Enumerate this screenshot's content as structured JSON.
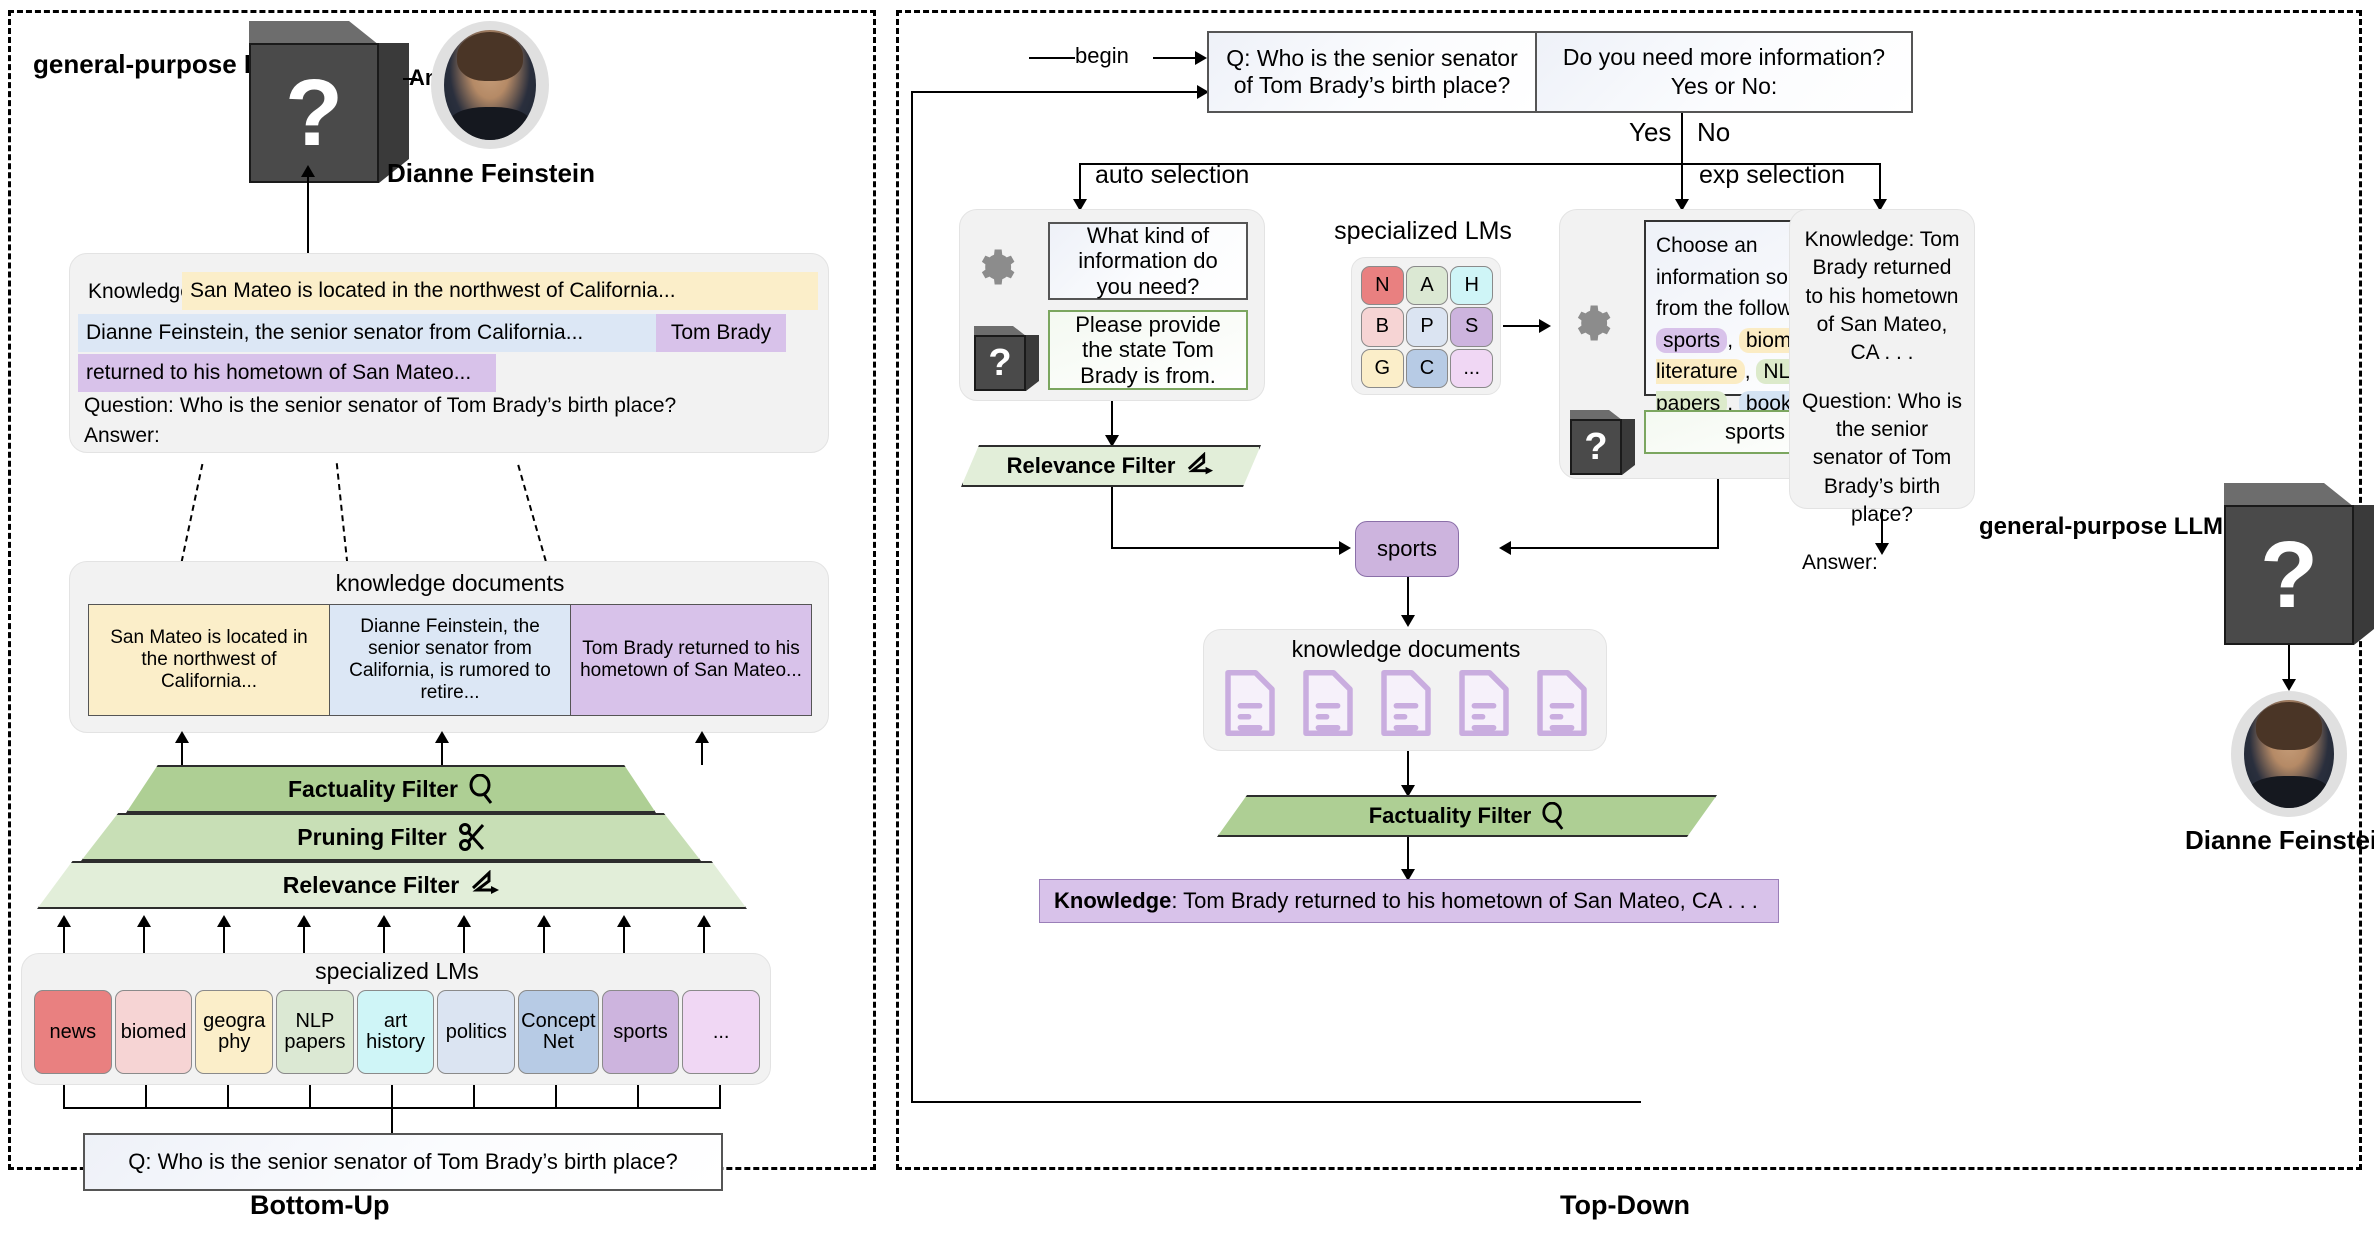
{
  "figure": {
    "caption_left": "Bottom-Up",
    "caption_right": "Top-Down"
  },
  "left": {
    "llm_label": "general-purpose LLM",
    "llm_glyph": "?",
    "answer_edge_label": "Answer:→",
    "person_name": "Dianne Feinstein",
    "prompt_box": {
      "knowledge_label": "Knowledge:",
      "knowledge_yellow": "San Mateo is located in the northwest of California...",
      "knowledge_blue": "Dianne Feinstein, the senior senator from California...",
      "tag_purple": "Tom Brady",
      "knowledge_purple": "returned to his hometown of San Mateo...",
      "question_line": "Question: Who is the senior senator of Tom Brady’s birth place?",
      "answer_line": "Answer:"
    },
    "knowledge_docs": {
      "title": "knowledge documents",
      "docs": [
        "San Mateo is located in the northwest of California...",
        "Dianne Feinstein, the senior senator from California, is rumored to retire...",
        "Tom Brady returned to his hometown of San Mateo..."
      ]
    },
    "filters": [
      {
        "label": "Factuality Filter",
        "icon": "magnifier-icon"
      },
      {
        "label": "Pruning Filter",
        "icon": "scissors-icon"
      },
      {
        "label": "Relevance Filter",
        "icon": "relevance-arrow-icon"
      }
    ],
    "specialized_lms": {
      "title": "specialized LMs",
      "items": [
        "news",
        "biomed",
        "geogra phy",
        "NLP papers",
        "art history",
        "politics",
        "Concept Net",
        "sports",
        "..."
      ],
      "colors": [
        "#e98080",
        "#f6d4d4",
        "#fbeec9",
        "#dbe8d3",
        "#cff5f7",
        "#dbe4f2",
        "#b7cbe5",
        "#cdb4de",
        "#f0d7f4"
      ]
    },
    "question": "Q: Who is the senior senator of Tom Brady’s birth place?"
  },
  "right": {
    "begin_label": "begin",
    "query_box": "Q: Who is the senior senator of Tom Brady’s birth place?",
    "need_info_box": "Do you need more information?\nYes or No:",
    "yes_label": "Yes",
    "no_label": "No",
    "auto_selection_label": "auto selection",
    "exp_selection_label": "exp selection",
    "auto_panel": {
      "gear_icon": "gear-icon",
      "llm_icon": "black-box-llm-icon",
      "prompt": "What kind of information do you need?",
      "response": "Please provide the state Tom Brady is from."
    },
    "specialized_lms": {
      "title": "specialized LMs",
      "grid": [
        "N",
        "A",
        "H",
        "B",
        "P",
        "S",
        "G",
        "C",
        "..."
      ],
      "colors": [
        "#e98080",
        "#dbe8d3",
        "#cff5f7",
        "#f6d4d4",
        "#dbe4f2",
        "#cdb4de",
        "#fbeec9",
        "#b7cbe5",
        "#f0d7f4"
      ]
    },
    "exp_panel": {
      "gear_icon": "gear-icon",
      "llm_icon": "black-box-llm-icon",
      "prompt_prefix": "Choose an information source from the following:",
      "options": [
        "sports",
        "biomedical literature",
        "NLP papers",
        "book corpus"
      ],
      "option_colors": [
        "#d8c2ea",
        "#fbecc4",
        "#dceacb",
        "#d4e3f3"
      ],
      "separators": [
        ",",
        ",",
        ",",
        "."
      ],
      "response": "sports"
    },
    "no_branch_box": {
      "knowledge": "Knowledge: Tom Brady returned to his hometown of San Mateo, CA . . .",
      "question": "Question: Who is the senior senator of Tom Brady’s birth place?",
      "answer": "Answer:"
    },
    "relevance_filter": {
      "label": "Relevance Filter",
      "icon": "relevance-arrow-icon"
    },
    "factuality_filter": {
      "label": "Factuality Filter",
      "icon": "magnifier-icon"
    },
    "selected_source": "sports",
    "knowledge_docs_title": "knowledge documents",
    "knowledge_docs_count": 5,
    "knowledge_bar": {
      "label": "Knowledge",
      "text": ": Tom Brady returned to his hometown of San Mateo, CA . . ."
    },
    "llm_label": "general-purpose LLM",
    "llm_glyph": "?",
    "person_name": "Dianne Feinstein"
  },
  "colors": {
    "yellow": "#fbeec9",
    "blue": "#dce7f5",
    "purple": "#d8c2ea",
    "green_dark": "#aecf94",
    "green_mid": "#c8dfb6",
    "green_light": "#e2eed9",
    "panel_gray": "#f2f2f2",
    "doc_purple": "#c9addf"
  }
}
